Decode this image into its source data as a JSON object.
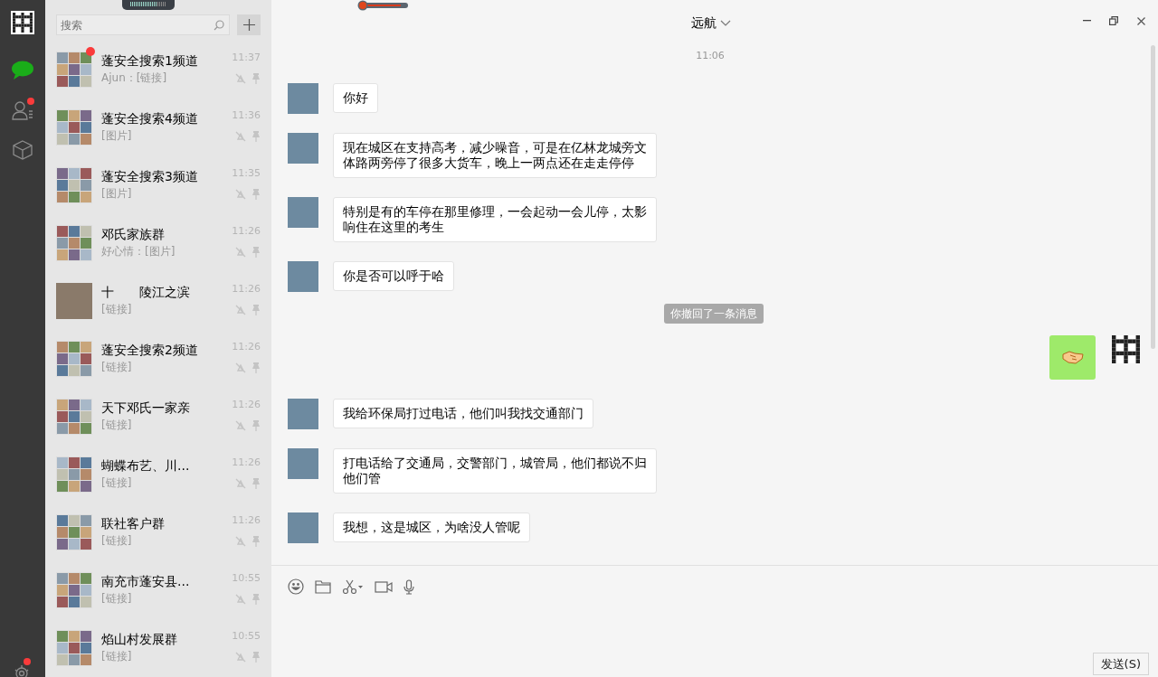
{
  "sidebar": {
    "nav": [
      {
        "kind": "chat",
        "selected": true,
        "badge": false
      },
      {
        "kind": "contacts",
        "selected": false,
        "badge": true
      },
      {
        "kind": "favorites",
        "selected": false,
        "badge": false
      }
    ],
    "settings": {
      "badge": true
    }
  },
  "search": {
    "placeholder": "搜索"
  },
  "chats": [
    {
      "name": "蓬安全搜索1频道",
      "preview": "Ajun：[链接]",
      "time": "11:37",
      "unread": true,
      "kind": "group"
    },
    {
      "name": "蓬安全搜索4频道",
      "preview": "[图片]",
      "time": "11:36",
      "unread": false,
      "kind": "group"
    },
    {
      "name": "蓬安全搜索3频道",
      "preview": "[图片]",
      "time": "11:35",
      "unread": false,
      "kind": "group"
    },
    {
      "name": "邓氏家族群",
      "preview": "好心情：[图片]",
      "time": "11:26",
      "unread": false,
      "kind": "group"
    },
    {
      "name": "十　　陵江之滨",
      "preview": "[链接]",
      "time": "11:26",
      "unread": false,
      "kind": "single"
    },
    {
      "name": "蓬安全搜索2频道",
      "preview": "[链接]",
      "time": "11:26",
      "unread": false,
      "kind": "group"
    },
    {
      "name": "天下邓氏一家亲",
      "preview": "[链接]",
      "time": "11:26",
      "unread": false,
      "kind": "group"
    },
    {
      "name": "蝴蝶布艺、川...",
      "preview": "[链接]",
      "time": "11:26",
      "unread": false,
      "kind": "group"
    },
    {
      "name": "联社客户群",
      "preview": "[链接]",
      "time": "11:26",
      "unread": false,
      "kind": "group"
    },
    {
      "name": "南充市蓬安县...",
      "preview": "[链接]",
      "time": "10:55",
      "unread": false,
      "kind": "group"
    },
    {
      "name": "焰山村发展群",
      "preview": "[链接]",
      "time": "10:55",
      "unread": false,
      "kind": "group"
    }
  ],
  "chat": {
    "title": "远航",
    "messages": [
      {
        "kind": "time",
        "text": "11:06"
      },
      {
        "kind": "incoming",
        "text": "你好"
      },
      {
        "kind": "incoming",
        "text": "现在城区在支持高考，减少噪音，可是在亿林龙城旁文体路两旁停了很多大货车，晚上一两点还在走走停停"
      },
      {
        "kind": "incoming",
        "text": "特别是有的车停在那里修理，一会起动一会儿停，太影响住在这里的考生"
      },
      {
        "kind": "incoming",
        "text": "你是否可以呼于哈"
      },
      {
        "kind": "system",
        "text": "你撤回了一条消息"
      },
      {
        "kind": "outgoing_sticker"
      },
      {
        "kind": "incoming",
        "text": "我给环保局打过电话，他们叫我找交通部门"
      },
      {
        "kind": "incoming",
        "text": "打电话给了交通局，交警部门，城管局，他们都说不归他们管"
      },
      {
        "kind": "incoming",
        "text": "我想，这是城区，为啥没人管呢"
      }
    ]
  },
  "send_button": "发送(S)"
}
